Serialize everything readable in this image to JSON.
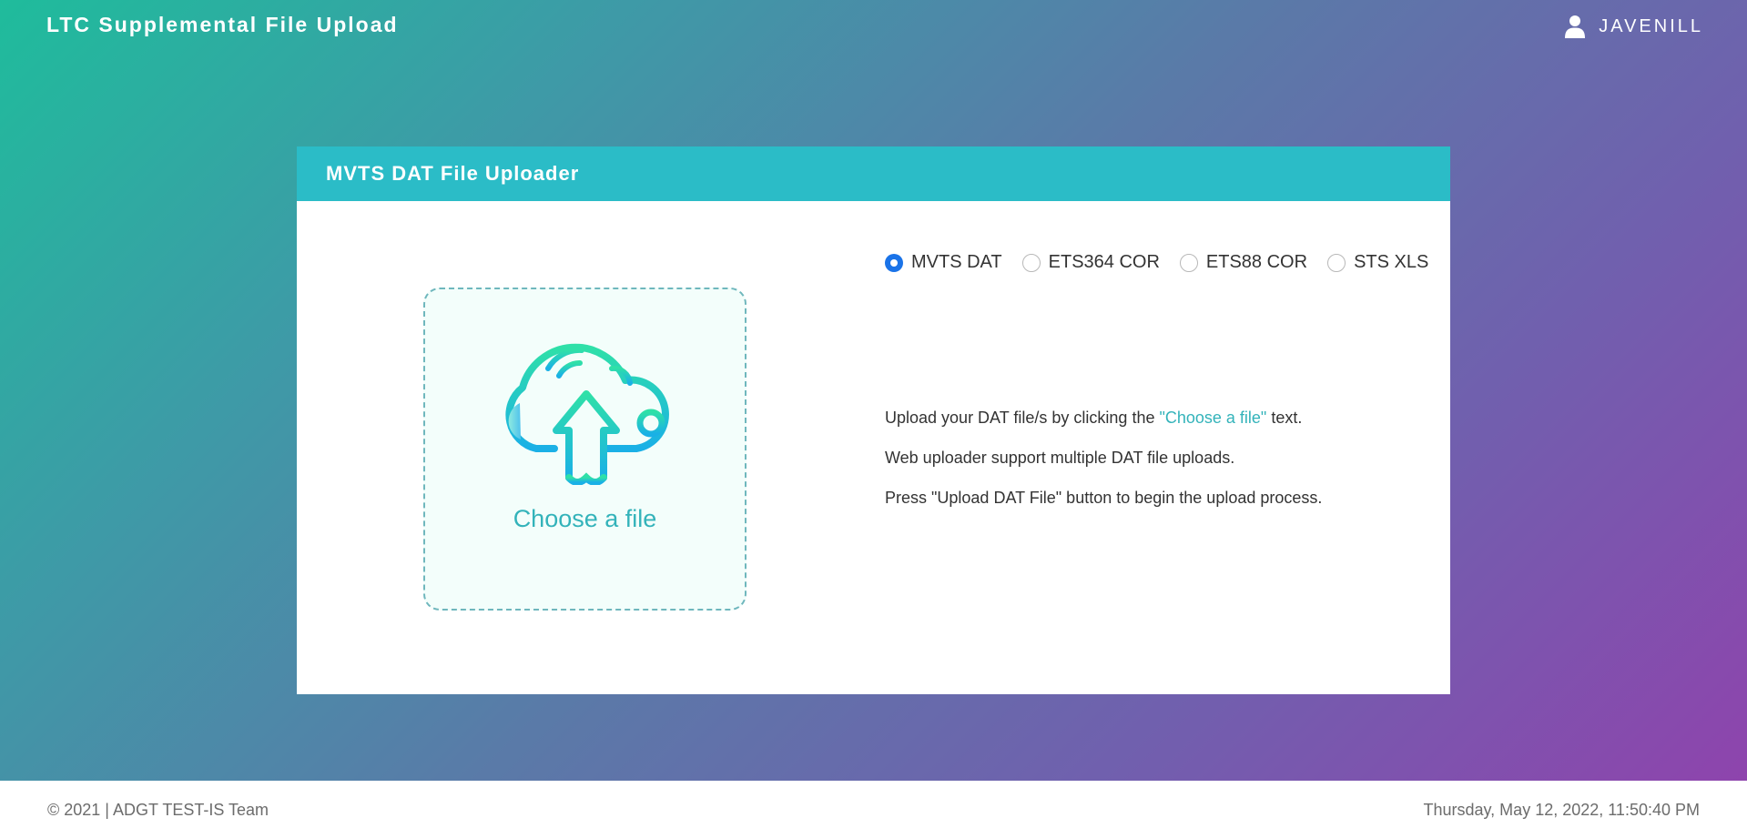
{
  "header": {
    "app_title": "LTC Supplemental File Upload",
    "user_name": "JAVENILL",
    "user_icon": "user-icon"
  },
  "card": {
    "title": "MVTS DAT File Uploader",
    "dropzone": {
      "icon": "cloud-upload-icon",
      "label": "Choose a file"
    },
    "file_types": [
      {
        "label": "MVTS DAT",
        "checked": true
      },
      {
        "label": "ETS364 COR",
        "checked": false
      },
      {
        "label": "ETS88 COR",
        "checked": false
      },
      {
        "label": "STS XLS",
        "checked": false
      }
    ],
    "instructions": {
      "line1_before": "Upload your DAT file/s by clicking the ",
      "line1_link": "\"Choose a file\"",
      "line1_after": " text.",
      "line2": "Web uploader support multiple DAT file uploads.",
      "line3": "Press \"Upload DAT File\" button to begin the upload process."
    }
  },
  "footer": {
    "copyright": "© 2021 | ADGT TEST-IS Team",
    "datetime": "Thursday, May 12, 2022, 11:50:40 PM"
  },
  "colors": {
    "accent": "#2bbcc7",
    "link": "#33b3ba",
    "radio_selected": "#1a73e8",
    "gradient_start": "#1fbc9c",
    "gradient_end": "#8e44ad"
  }
}
